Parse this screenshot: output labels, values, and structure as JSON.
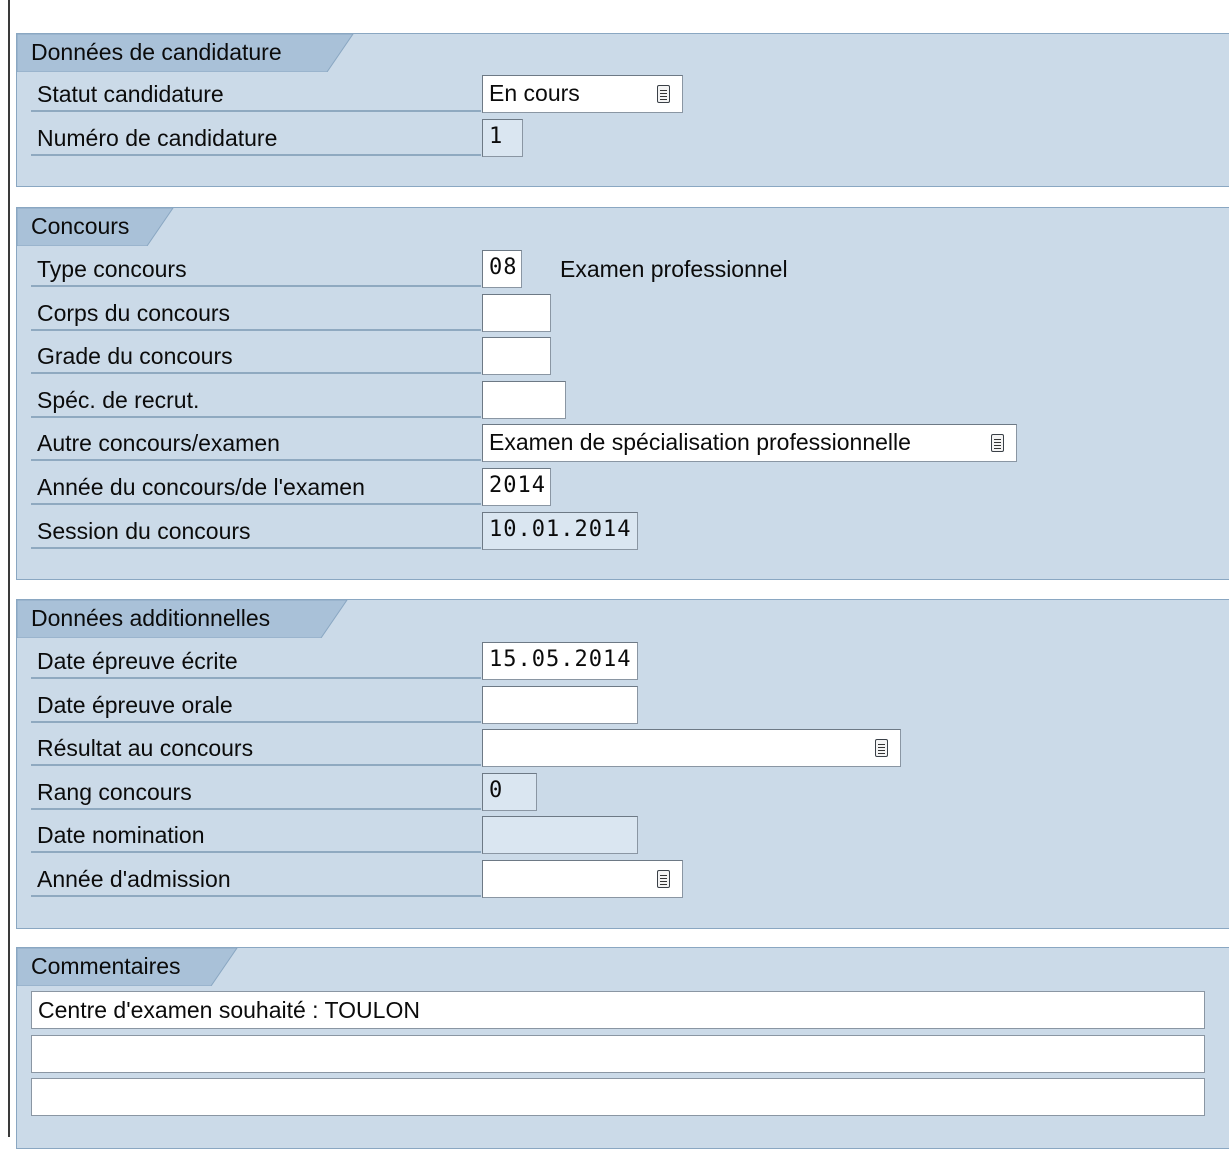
{
  "candidature": {
    "title": "Données de candidature",
    "statut_label": "Statut candidature",
    "statut_value": "En cours",
    "numero_label": "Numéro de candidature",
    "numero_value": "1"
  },
  "concours": {
    "title": "Concours",
    "type_label": "Type concours",
    "type_value": "08",
    "type_desc": "Examen professionnel",
    "corps_label": "Corps du concours",
    "corps_value": "",
    "grade_label": "Grade du concours",
    "grade_value": "",
    "spec_label": "Spéc. de recrut.",
    "spec_value": "",
    "autre_label": "Autre concours/examen",
    "autre_value": "Examen de spécialisation professionnelle",
    "annee_label": "Année du concours/de l'examen",
    "annee_value": "2014",
    "session_label": "Session du concours",
    "session_value": "10.01.2014"
  },
  "additionnelles": {
    "title": "Données additionnelles",
    "ecrite_label": "Date épreuve écrite",
    "ecrite_value": "15.05.2014",
    "orale_label": "Date épreuve orale",
    "orale_value": "",
    "resultat_label": "Résultat au concours",
    "resultat_value": "",
    "rang_label": "Rang concours",
    "rang_value": "0",
    "nomination_label": "Date nomination",
    "nomination_value": "",
    "admission_label": "Année d'admission",
    "admission_value": ""
  },
  "commentaires": {
    "title": "Commentaires",
    "lines": [
      "Centre d'examen souhaité : TOULON",
      "",
      ""
    ]
  },
  "icons": {
    "dropdown": "list-picker-icon"
  },
  "colors": {
    "group_bg": "#cbdae8",
    "tab_bg": "#a9c1d8",
    "border": "#8aa7c2"
  }
}
